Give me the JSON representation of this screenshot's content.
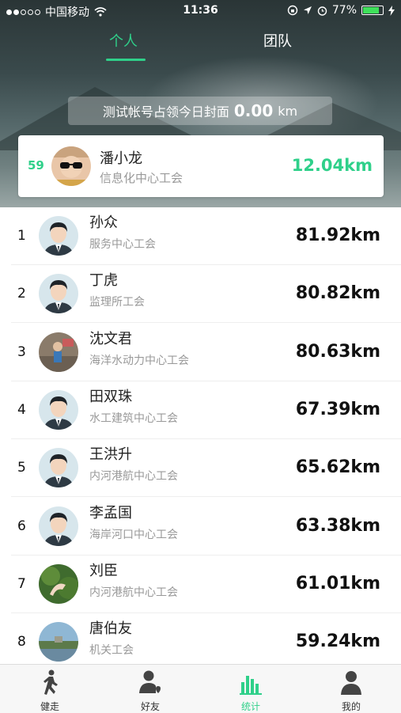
{
  "status_bar": {
    "carrier": "中国移动",
    "time": "11:36",
    "battery": "77%"
  },
  "tabs": [
    {
      "label": "个人",
      "active": true
    },
    {
      "label": "团队",
      "active": false
    }
  ],
  "banner": {
    "prefix": "测试帐号占领今日封面",
    "value": "0.00",
    "unit": "km"
  },
  "my_rank": {
    "rank": "59",
    "name": "潘小龙",
    "org": "信息化中心工会",
    "km": "12.04km"
  },
  "ranking": [
    {
      "rank": "1",
      "name": "孙众",
      "org": "服务中心工会",
      "km": "81.92km",
      "avatar": "default-avatar-icon"
    },
    {
      "rank": "2",
      "name": "丁虎",
      "org": "监理所工会",
      "km": "80.82km",
      "avatar": "default-avatar-icon"
    },
    {
      "rank": "3",
      "name": "沈文君",
      "org": "海洋水动力中心工会",
      "km": "80.63km",
      "avatar": "photo-avatar"
    },
    {
      "rank": "4",
      "name": "田双珠",
      "org": "水工建筑中心工会",
      "km": "67.39km",
      "avatar": "default-avatar-icon"
    },
    {
      "rank": "5",
      "name": "王洪升",
      "org": "内河港航中心工会",
      "km": "65.62km",
      "avatar": "default-avatar-icon"
    },
    {
      "rank": "6",
      "name": "李孟国",
      "org": "海岸河口中心工会",
      "km": "63.38km",
      "avatar": "default-avatar-icon"
    },
    {
      "rank": "7",
      "name": "刘臣",
      "org": "内河港航中心工会",
      "km": "61.01km",
      "avatar": "photo-avatar"
    },
    {
      "rank": "8",
      "name": "唐伯友",
      "org": "机关工会",
      "km": "59.24km",
      "avatar": "photo-avatar"
    }
  ],
  "tabbar": [
    {
      "label": "健走",
      "icon": "walking-icon",
      "active": false
    },
    {
      "label": "好友",
      "icon": "friends-icon",
      "active": false
    },
    {
      "label": "统计",
      "icon": "stats-icon",
      "active": true
    },
    {
      "label": "我的",
      "icon": "profile-icon",
      "active": false
    }
  ],
  "colors": {
    "accent": "#2fd08a"
  }
}
